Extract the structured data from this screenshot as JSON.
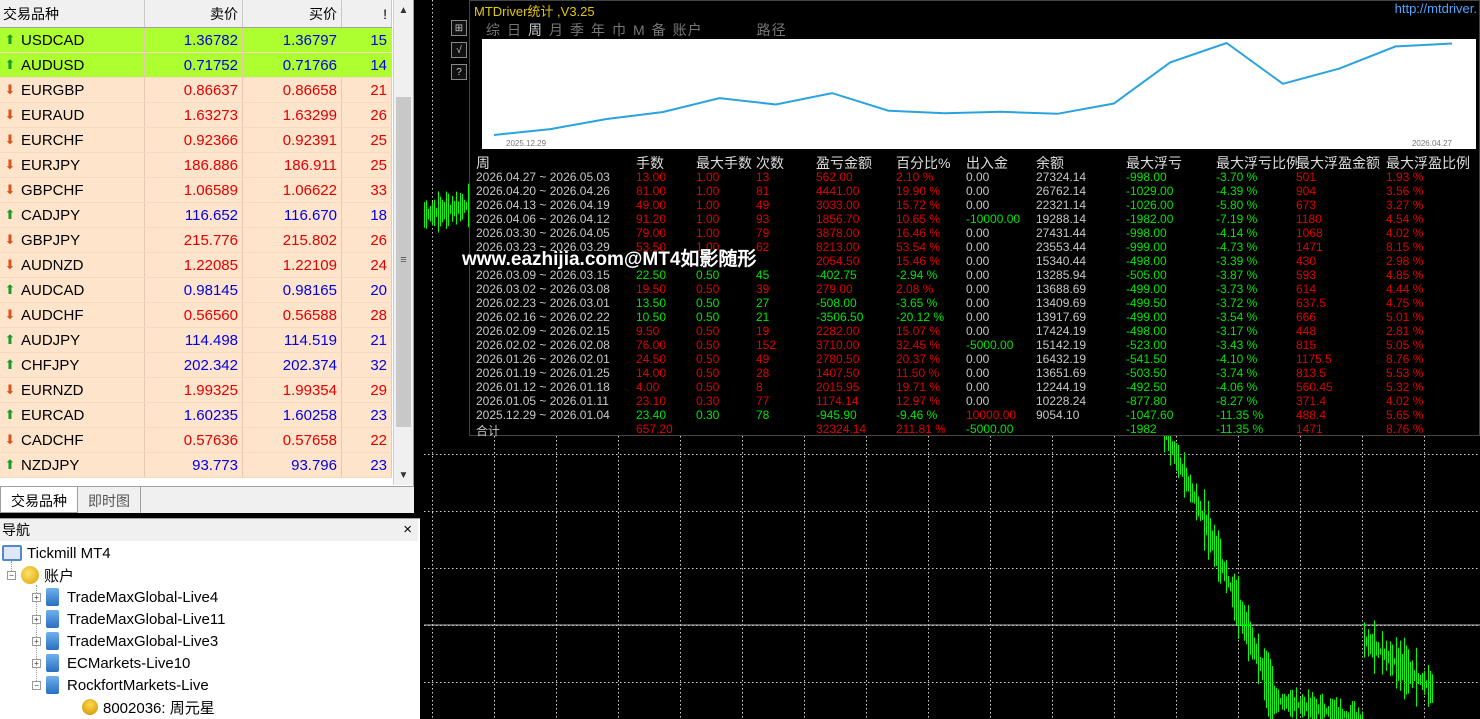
{
  "market_watch": {
    "columns": {
      "symbol": "交易品种",
      "bid": "卖价",
      "ask": "买价",
      "spread": "!"
    },
    "rows": [
      {
        "symbol": "USDCAD",
        "bid": "1.36782",
        "ask": "1.36797",
        "spread": "15",
        "dir": "up",
        "highlight": true,
        "price_color": "#0000e0"
      },
      {
        "symbol": "AUDUSD",
        "bid": "0.71752",
        "ask": "0.71766",
        "spread": "14",
        "dir": "up",
        "highlight": true,
        "price_color": "#0000e0"
      },
      {
        "symbol": "EURGBP",
        "bid": "0.86637",
        "ask": "0.86658",
        "spread": "21",
        "dir": "down",
        "highlight": false,
        "price_color": "#e00000"
      },
      {
        "symbol": "EURAUD",
        "bid": "1.63273",
        "ask": "1.63299",
        "spread": "26",
        "dir": "down",
        "highlight": false,
        "price_color": "#e00000"
      },
      {
        "symbol": "EURCHF",
        "bid": "0.92366",
        "ask": "0.92391",
        "spread": "25",
        "dir": "down",
        "highlight": false,
        "price_color": "#e00000"
      },
      {
        "symbol": "EURJPY",
        "bid": "186.886",
        "ask": "186.911",
        "spread": "25",
        "dir": "down",
        "highlight": false,
        "price_color": "#e00000"
      },
      {
        "symbol": "GBPCHF",
        "bid": "1.06589",
        "ask": "1.06622",
        "spread": "33",
        "dir": "down",
        "highlight": false,
        "price_color": "#e00000"
      },
      {
        "symbol": "CADJPY",
        "bid": "116.652",
        "ask": "116.670",
        "spread": "18",
        "dir": "up",
        "highlight": false,
        "price_color": "#0000e0"
      },
      {
        "symbol": "GBPJPY",
        "bid": "215.776",
        "ask": "215.802",
        "spread": "26",
        "dir": "down",
        "highlight": false,
        "price_color": "#e00000"
      },
      {
        "symbol": "AUDNZD",
        "bid": "1.22085",
        "ask": "1.22109",
        "spread": "24",
        "dir": "down",
        "highlight": false,
        "price_color": "#e00000"
      },
      {
        "symbol": "AUDCAD",
        "bid": "0.98145",
        "ask": "0.98165",
        "spread": "20",
        "dir": "up",
        "highlight": false,
        "price_color": "#0000e0"
      },
      {
        "symbol": "AUDCHF",
        "bid": "0.56560",
        "ask": "0.56588",
        "spread": "28",
        "dir": "down",
        "highlight": false,
        "price_color": "#e00000"
      },
      {
        "symbol": "AUDJPY",
        "bid": "114.498",
        "ask": "114.519",
        "spread": "21",
        "dir": "up",
        "highlight": false,
        "price_color": "#0000e0"
      },
      {
        "symbol": "CHFJPY",
        "bid": "202.342",
        "ask": "202.374",
        "spread": "32",
        "dir": "up",
        "highlight": false,
        "price_color": "#0000e0"
      },
      {
        "symbol": "EURNZD",
        "bid": "1.99325",
        "ask": "1.99354",
        "spread": "29",
        "dir": "down",
        "highlight": false,
        "price_color": "#e00000"
      },
      {
        "symbol": "EURCAD",
        "bid": "1.60235",
        "ask": "1.60258",
        "spread": "23",
        "dir": "up",
        "highlight": false,
        "price_color": "#0000e0"
      },
      {
        "symbol": "CADCHF",
        "bid": "0.57636",
        "ask": "0.57658",
        "spread": "22",
        "dir": "down",
        "highlight": false,
        "price_color": "#e00000"
      },
      {
        "symbol": "NZDJPY",
        "bid": "93.773",
        "ask": "93.796",
        "spread": "23",
        "dir": "up",
        "highlight": false,
        "price_color": "#0000e0"
      }
    ],
    "tabs": {
      "symbols": "交易品种",
      "tick_chart": "即时图"
    }
  },
  "navigator": {
    "title": "导航",
    "close": "×",
    "root": "Tickmill MT4",
    "accounts_label": "账户",
    "servers": [
      "TradeMaxGlobal-Live4",
      "TradeMaxGlobal-Live11",
      "TradeMaxGlobal-Live3",
      "ECMarkets-Live10",
      "RockfortMarkets-Live"
    ],
    "account": "8002036: 周元星"
  },
  "panel": {
    "title": "MTDriver统计 ,V3.25",
    "url": "http://mtdriver.",
    "side_buttons": [
      "⊞",
      "√",
      "?"
    ],
    "period_tabs": [
      "综",
      "日",
      "周",
      "月",
      "季",
      "年",
      "巾",
      "M",
      "备",
      "账户"
    ],
    "period_selected": "周",
    "extra_tab": "路径",
    "curve_start": "2025.12.29",
    "curve_end": "2026.04.27",
    "headers": [
      "周",
      "手数",
      "最大手数",
      "次数",
      "盈亏金额",
      "百分比%",
      "出入金",
      "余额",
      "最大浮亏",
      "最大浮亏比例",
      "最大浮盈金额",
      "最大浮盈比例"
    ],
    "rows": [
      [
        "2026.04.27 ~ 2026.05.03",
        "13.00",
        "1.00",
        "13",
        "562.00",
        "2.10 %",
        "0.00",
        "27324.14",
        "-998.00",
        "-3.70 %",
        "501",
        "1.93 %"
      ],
      [
        "2026.04.20 ~ 2026.04.26",
        "81.00",
        "1.00",
        "81",
        "4441.00",
        "19.90 %",
        "0.00",
        "26762.14",
        "-1029.00",
        "-4.39 %",
        "904",
        "3.56 %"
      ],
      [
        "2026.04.13 ~ 2026.04.19",
        "49.00",
        "1.00",
        "49",
        "3033.00",
        "15.72 %",
        "0.00",
        "22321.14",
        "-1026.00",
        "-5.80 %",
        "673",
        "3.27 %"
      ],
      [
        "2026.04.06 ~ 2026.04.12",
        "91.20",
        "1.00",
        "93",
        "1856.70",
        "10.65 %",
        "-10000.00",
        "19288.14",
        "-1982.00",
        "-7.19 %",
        "1180",
        "4.54 %"
      ],
      [
        "2026.03.30 ~ 2026.04.05",
        "79.00",
        "1.00",
        "79",
        "3878.00",
        "16.46 %",
        "0.00",
        "27431.44",
        "-998.00",
        "-4.14 %",
        "1068",
        "4.02 %"
      ],
      [
        "2026.03.23 ~ 2026.03.29",
        "53.50",
        "1.00",
        "62",
        "8213.00",
        "53.54 %",
        "0.00",
        "23553.44",
        "-999.00",
        "-4.73 %",
        "1471",
        "8.15 %"
      ],
      [
        "",
        "",
        "",
        "",
        "2054.50",
        "15.46 %",
        "0.00",
        "15340.44",
        "-498.00",
        "-3.39 %",
        "430",
        "2.98 %"
      ],
      [
        "2026.03.09 ~ 2026.03.15",
        "22.50",
        "0.50",
        "45",
        "-402.75",
        "-2.94 %",
        "0.00",
        "13285.94",
        "-505.00",
        "-3.87 %",
        "593",
        "4.85 %"
      ],
      [
        "2026.03.02 ~ 2026.03.08",
        "19.50",
        "0.50",
        "39",
        "279.00",
        "2.08 %",
        "0.00",
        "13688.69",
        "-499.00",
        "-3.73 %",
        "614",
        "4.44 %"
      ],
      [
        "2026.02.23 ~ 2026.03.01",
        "13.50",
        "0.50",
        "27",
        "-508.00",
        "-3.65 %",
        "0.00",
        "13409.69",
        "-499.50",
        "-3.72 %",
        "637.5",
        "4.75 %"
      ],
      [
        "2026.02.16 ~ 2026.02.22",
        "10.50",
        "0.50",
        "21",
        "-3506.50",
        "-20.12 %",
        "0.00",
        "13917.69",
        "-499.00",
        "-3.54 %",
        "666",
        "5.01 %"
      ],
      [
        "2026.02.09 ~ 2026.02.15",
        "9.50",
        "0.50",
        "19",
        "2282.00",
        "15.07 %",
        "0.00",
        "17424.19",
        "-498.00",
        "-3.17 %",
        "448",
        "2.81 %"
      ],
      [
        "2026.02.02 ~ 2026.02.08",
        "76.00",
        "0.50",
        "152",
        "3710.00",
        "32.45 %",
        "-5000.00",
        "15142.19",
        "-523.00",
        "-3.43 %",
        "815",
        "5.05 %"
      ],
      [
        "2026.01.26 ~ 2026.02.01",
        "24.50",
        "0.50",
        "49",
        "2780.50",
        "20.37 %",
        "0.00",
        "16432.19",
        "-541.50",
        "-4.10 %",
        "1175.5",
        "8.76 %"
      ],
      [
        "2026.01.19 ~ 2026.01.25",
        "14.00",
        "0.50",
        "28",
        "1407.50",
        "11.50 %",
        "0.00",
        "13651.69",
        "-503.50",
        "-3.74 %",
        "813.5",
        "5.53 %"
      ],
      [
        "2026.01.12 ~ 2026.01.18",
        "4.00",
        "0.50",
        "8",
        "2015.95",
        "19.71 %",
        "0.00",
        "12244.19",
        "-492.50",
        "-4.06 %",
        "560.45",
        "5.32 %"
      ],
      [
        "2026.01.05 ~ 2026.01.11",
        "23.10",
        "0.30",
        "77",
        "1174.14",
        "12.97 %",
        "0.00",
        "10228.24",
        "-877.80",
        "-8.27 %",
        "371.4",
        "4.02 %"
      ],
      [
        "2025.12.29 ~ 2026.01.04",
        "23.40",
        "0.30",
        "78",
        "-945.90",
        "-9.46 %",
        "10000.00",
        "9054.10",
        "-1047.60",
        "-11.35 %",
        "488.4",
        "5.65 %"
      ]
    ],
    "total": {
      "label": "合计",
      "lots": "657.20",
      "pnl": "32324.14",
      "percent": "211.81 %",
      "deposit": "-5000.00",
      "max_float_loss": "-1982",
      "max_float_loss_pct": "-11.35 %",
      "max_float_profit": "1471",
      "max_float_profit_pct": "8.76 %"
    }
  },
  "watermark": "www.eazhijia.com@MT4如影随形",
  "colors": {
    "highlight_row": "#adff2f",
    "row_bg": "#ffe4cc",
    "up": "#0000e0",
    "down": "#e00000",
    "candles": "#00ff00",
    "curve": "#29a3e0"
  }
}
